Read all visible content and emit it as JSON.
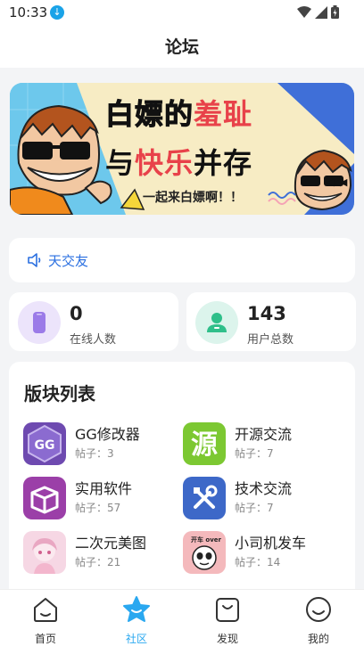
{
  "status": {
    "time": "10:33"
  },
  "header": {
    "title": "论坛"
  },
  "banner": {
    "line1_a": "白嫖的",
    "line1_b": "羞耻",
    "line2_a": "与",
    "line2_b": "快乐",
    "line2_c": "并存",
    "tagline": "一起来白嫖啊！！",
    "colors": {
      "sky": "#6dc8ec",
      "cream": "#f7ecc4",
      "red": "#e8424a",
      "orange": "#f08a1c"
    }
  },
  "notice": {
    "text": "天交友"
  },
  "stats": [
    {
      "value": "0",
      "label": "在线人数",
      "icon": "phone-icon",
      "color": "#ece4fb"
    },
    {
      "value": "143",
      "label": "用户总数",
      "icon": "user-icon",
      "color": "#dcf4ec"
    }
  ],
  "sections": {
    "title": "版块列表",
    "items": [
      {
        "name": "GG修改器",
        "count": "帖子：3",
        "icon": "gg-logo-icon"
      },
      {
        "name": "开源交流",
        "count": "帖子：7",
        "icon": "yuan-icon"
      },
      {
        "name": "实用软件",
        "count": "帖子：57",
        "icon": "box-icon"
      },
      {
        "name": "技术交流",
        "count": "帖子：7",
        "icon": "tools-icon"
      },
      {
        "name": "二次元美图",
        "count": "帖子：21",
        "icon": "anime-girl-icon"
      },
      {
        "name": "小司机发车",
        "count": "帖子：14",
        "icon": "panda-meme-icon"
      }
    ]
  },
  "tabs": [
    {
      "label": "首页",
      "icon": "home-icon"
    },
    {
      "label": "社区",
      "icon": "star-icon",
      "active": true
    },
    {
      "label": "发现",
      "icon": "bag-icon"
    },
    {
      "label": "我的",
      "icon": "smile-icon"
    }
  ]
}
